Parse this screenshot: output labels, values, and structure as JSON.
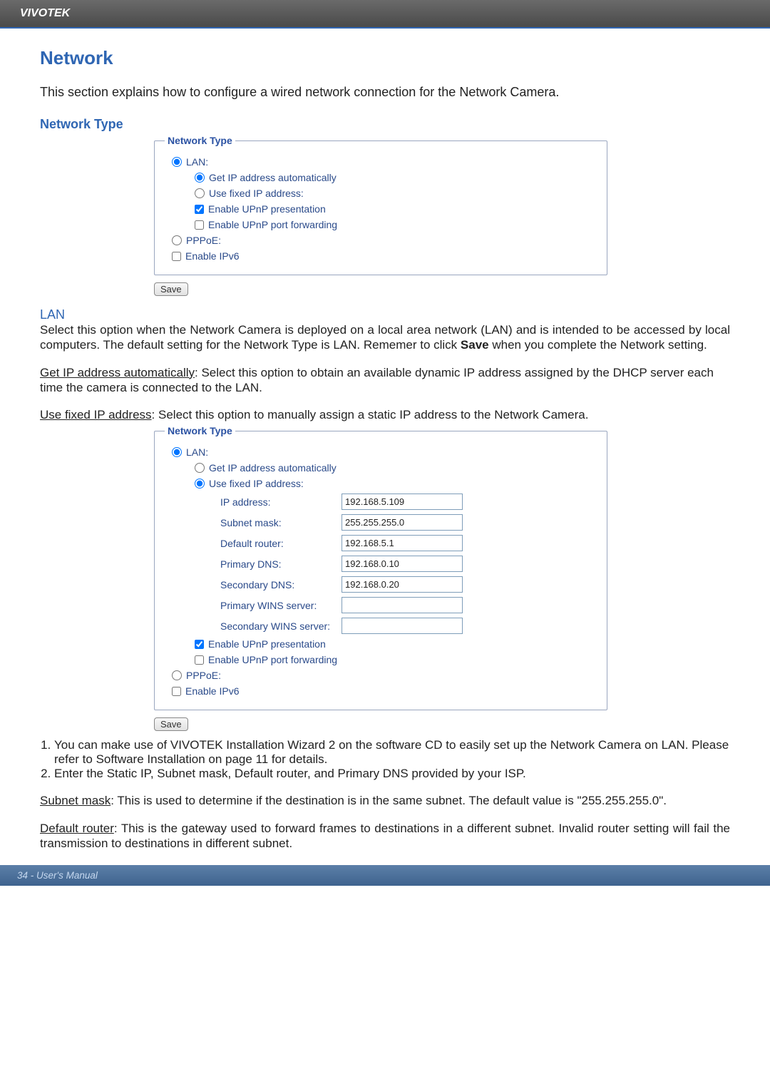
{
  "header": {
    "brand": "VIVOTEK"
  },
  "headings": {
    "title": "Network",
    "type_section": "Network Type",
    "lan_heading": "LAN"
  },
  "intro_text": "This section explains how to configure a wired network connection for the Network Camera.",
  "fieldset_legend": "Network Type",
  "labels": {
    "lan": "LAN:",
    "get_ip_auto": "Get IP address automatically",
    "use_fixed_ip": "Use fixed IP address:",
    "enable_upnp_present": "Enable UPnP presentation",
    "enable_upnp_forward": "Enable UPnP port forwarding",
    "pppoe": "PPPoE:",
    "enable_ipv6": "Enable IPv6",
    "save": "Save",
    "ip_address": "IP address:",
    "subnet_mask": "Subnet mask:",
    "default_router": "Default router:",
    "primary_dns": "Primary DNS:",
    "secondary_dns": "Secondary DNS:",
    "primary_wins": "Primary WINS server:",
    "secondary_wins": "Secondary WINS server:"
  },
  "ip_values": {
    "ip_address": "192.168.5.109",
    "subnet_mask": "255.255.255.0",
    "default_router": "192.168.5.1",
    "primary_dns": "192.168.0.10",
    "secondary_dns": "192.168.0.20",
    "primary_wins": "",
    "secondary_wins": ""
  },
  "body": {
    "lan_p1": "Select this option when the Network Camera is deployed on a local area network (LAN) and is intended to be accessed by local computers. The default setting for the Network Type is LAN. Rememer to click ",
    "lan_p1_bold": "Save",
    "lan_p1_after": " when you complete the Network setting.",
    "get_ip_underline": "Get IP address automatically",
    "get_ip_rest": ": Select this option to obtain an available dynamic IP address assigned by the DHCP server each time the camera is connected to the LAN.",
    "use_fixed_underline": "Use fixed IP address",
    "use_fixed_rest": ": Select this option to manually assign a static IP address to the Network Camera.",
    "note1": "You can make use of VIVOTEK Installation Wizard 2 on the software CD to easily set up the Network Camera on LAN. Please refer to Software Installation on page 11 for details.",
    "note2": "Enter the Static IP, Subnet mask, Default router, and Primary DNS provided by your ISP.",
    "subnet_u": "Subnet mask",
    "subnet_rest": ": This is used to determine if the destination is in the same subnet. The default value is \"255.255.255.0\".",
    "router_u": "Default router",
    "router_rest": ": This is the gateway used to forward frames to destinations in a different subnet. Invalid router setting will fail the transmission to destinations in different subnet."
  },
  "footer": {
    "page": "34 - User's Manual"
  }
}
